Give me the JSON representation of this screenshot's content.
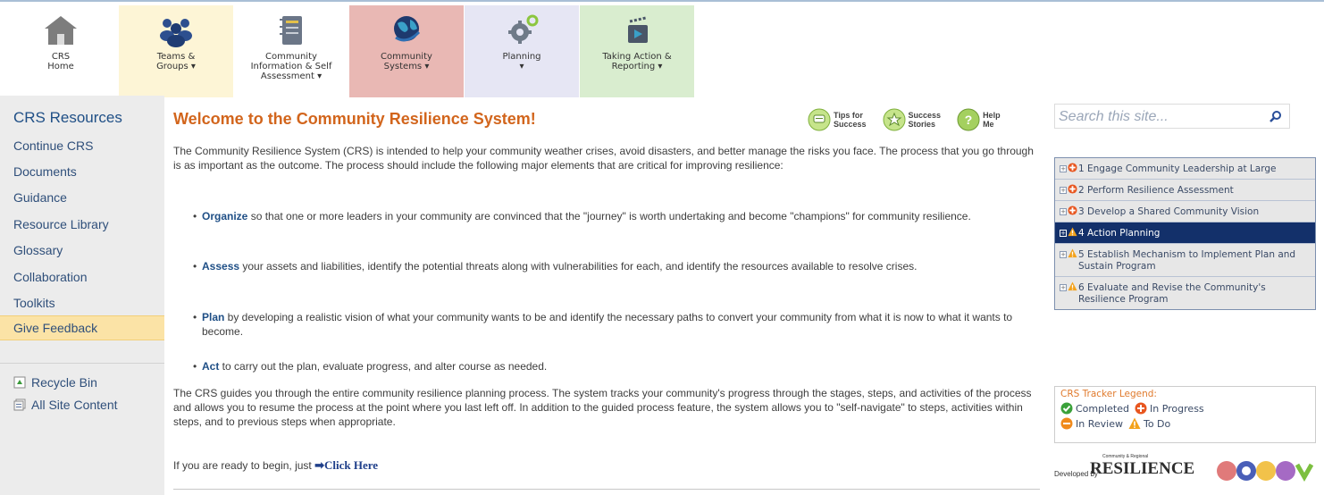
{
  "nav": {
    "tabs": [
      {
        "label_l1": "CRS",
        "label_l2": "Home",
        "label_l3": "",
        "color": "#ffffff"
      },
      {
        "label_l1": "Teams &",
        "label_l2": "Groups ▾",
        "label_l3": "",
        "color": "#fdf5d6"
      },
      {
        "label_l1": "Community",
        "label_l2": "Information & Self",
        "label_l3": "Assessment ▾",
        "color": "#ffffff"
      },
      {
        "label_l1": "Community",
        "label_l2": "Systems ▾",
        "label_l3": "",
        "color": "#e9b8b4"
      },
      {
        "label_l1": "Planning",
        "label_l2": "▾",
        "label_l3": "",
        "color": "#e6e6f4"
      },
      {
        "label_l1": "Taking Action &",
        "label_l2": "Reporting ▾",
        "label_l3": "",
        "color": "#d9edcf"
      }
    ]
  },
  "sidebar": {
    "heading": "CRS Resources",
    "items": [
      "Continue CRS",
      "Documents",
      "Guidance",
      "Resource Library",
      "Glossary",
      "Collaboration",
      "Toolkits"
    ],
    "feedback": "Give Feedback",
    "utility": [
      "Recycle Bin",
      "All Site Content"
    ]
  },
  "main": {
    "title": "Welcome to the Community Resilience System!",
    "help_links": [
      {
        "l1": "Tips for",
        "l2": "Success"
      },
      {
        "l1": "Success",
        "l2": "Stories"
      },
      {
        "l1": "Help",
        "l2": "Me"
      }
    ],
    "intro": "The Community Resilience System (CRS) is intended to help your community weather crises, avoid disasters, and better manage the risks you face. The process that you go through is as important as the outcome. The process should include the following major elements that are critical for improving resilience:",
    "bullets": [
      {
        "term": "Organize",
        "text": " so that one or more leaders in your community are convinced that the \"journey\" is worth undertaking and become \"champions\" for community resilience."
      },
      {
        "term": "Assess",
        "text": " your assets and liabilities, identify the potential threats along with vulnerabilities for each, and identify the resources available to resolve crises."
      },
      {
        "term": "Plan",
        "text": " by developing a realistic vision of what your community wants to be and identify the necessary paths to convert your community from what it is now to what it wants to become."
      },
      {
        "term": "Act",
        "text": " to carry out the plan, evaluate progress, and alter course as needed."
      }
    ],
    "closing": "The CRS guides you through the entire community resilience planning process. The system tracks your community's progress through the stages, steps, and activities of the process and allows you to resume the process at the point where you last left off. In addition to the guided process feature, the system allows you to \"self-navigate\" to steps, activities within steps, and to previous steps when appropriate.",
    "begin_text": "If you are ready to begin, just",
    "begin_link": "➡Click Here"
  },
  "search": {
    "placeholder": "Search this site..."
  },
  "steps": [
    {
      "label": "1 Engage Community Leadership at Large",
      "status": "in-progress"
    },
    {
      "label": "2 Perform Resilience Assessment",
      "status": "in-progress"
    },
    {
      "label": "3 Develop a Shared Community Vision",
      "status": "in-progress"
    },
    {
      "label": "4 Action Planning",
      "status": "to-do"
    },
    {
      "label": "5 Establish Mechanism to Implement Plan and Sustain Program",
      "status": "to-do"
    },
    {
      "label": "6 Evaluate and Revise the Community's Resilience Program",
      "status": "to-do"
    }
  ],
  "legend": {
    "title": "CRS Tracker Legend:",
    "completed": "Completed",
    "in_progress": "In Progress",
    "in_review": "In Review",
    "to_do": "To Do"
  },
  "developed_by": {
    "label": "Developed by",
    "logo_top": "Community & Regional",
    "logo_text": "RESILIENCE"
  },
  "colors": {
    "accent": "#d2651c",
    "link": "#1f4f86",
    "active_step": "#13306a"
  }
}
